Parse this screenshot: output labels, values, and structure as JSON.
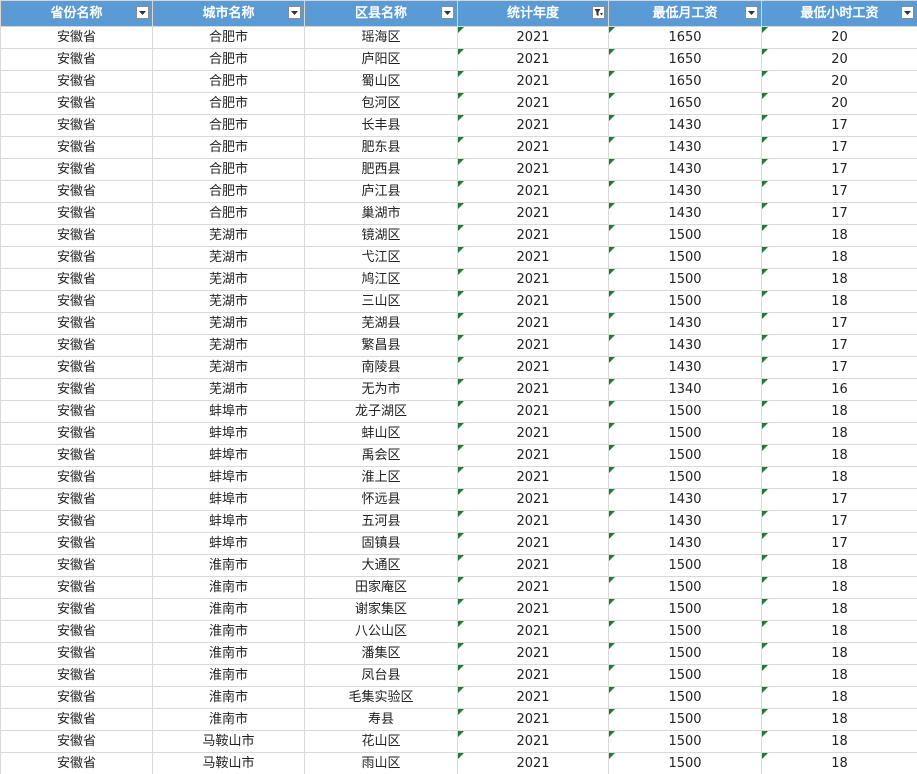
{
  "headers": [
    "省份名称",
    "城市名称",
    "区县名称",
    "统计年度",
    "最低月工资",
    "最低小时工资"
  ],
  "filter_icons": [
    "dropdown-arrow-icon",
    "dropdown-arrow-icon",
    "dropdown-arrow-icon",
    "filter-active-icon",
    "dropdown-arrow-icon",
    "dropdown-arrow-icon"
  ],
  "colors": {
    "header_bg": "#5b9bd5",
    "header_text": "#ffffff",
    "grid": "#d9d9d9",
    "error_marker": "#1e7d32"
  },
  "rows": [
    [
      "安徽省",
      "合肥市",
      "瑶海区",
      "2021",
      "1650",
      "20"
    ],
    [
      "安徽省",
      "合肥市",
      "庐阳区",
      "2021",
      "1650",
      "20"
    ],
    [
      "安徽省",
      "合肥市",
      "蜀山区",
      "2021",
      "1650",
      "20"
    ],
    [
      "安徽省",
      "合肥市",
      "包河区",
      "2021",
      "1650",
      "20"
    ],
    [
      "安徽省",
      "合肥市",
      "长丰县",
      "2021",
      "1430",
      "17"
    ],
    [
      "安徽省",
      "合肥市",
      "肥东县",
      "2021",
      "1430",
      "17"
    ],
    [
      "安徽省",
      "合肥市",
      "肥西县",
      "2021",
      "1430",
      "17"
    ],
    [
      "安徽省",
      "合肥市",
      "庐江县",
      "2021",
      "1430",
      "17"
    ],
    [
      "安徽省",
      "合肥市",
      "巢湖市",
      "2021",
      "1430",
      "17"
    ],
    [
      "安徽省",
      "芜湖市",
      "镜湖区",
      "2021",
      "1500",
      "18"
    ],
    [
      "安徽省",
      "芜湖市",
      "弋江区",
      "2021",
      "1500",
      "18"
    ],
    [
      "安徽省",
      "芜湖市",
      "鸠江区",
      "2021",
      "1500",
      "18"
    ],
    [
      "安徽省",
      "芜湖市",
      "三山区",
      "2021",
      "1500",
      "18"
    ],
    [
      "安徽省",
      "芜湖市",
      "芜湖县",
      "2021",
      "1430",
      "17"
    ],
    [
      "安徽省",
      "芜湖市",
      "繁昌县",
      "2021",
      "1430",
      "17"
    ],
    [
      "安徽省",
      "芜湖市",
      "南陵县",
      "2021",
      "1430",
      "17"
    ],
    [
      "安徽省",
      "芜湖市",
      "无为市",
      "2021",
      "1340",
      "16"
    ],
    [
      "安徽省",
      "蚌埠市",
      "龙子湖区",
      "2021",
      "1500",
      "18"
    ],
    [
      "安徽省",
      "蚌埠市",
      "蚌山区",
      "2021",
      "1500",
      "18"
    ],
    [
      "安徽省",
      "蚌埠市",
      "禹会区",
      "2021",
      "1500",
      "18"
    ],
    [
      "安徽省",
      "蚌埠市",
      "淮上区",
      "2021",
      "1500",
      "18"
    ],
    [
      "安徽省",
      "蚌埠市",
      "怀远县",
      "2021",
      "1430",
      "17"
    ],
    [
      "安徽省",
      "蚌埠市",
      "五河县",
      "2021",
      "1430",
      "17"
    ],
    [
      "安徽省",
      "蚌埠市",
      "固镇县",
      "2021",
      "1430",
      "17"
    ],
    [
      "安徽省",
      "淮南市",
      "大通区",
      "2021",
      "1500",
      "18"
    ],
    [
      "安徽省",
      "淮南市",
      "田家庵区",
      "2021",
      "1500",
      "18"
    ],
    [
      "安徽省",
      "淮南市",
      "谢家集区",
      "2021",
      "1500",
      "18"
    ],
    [
      "安徽省",
      "淮南市",
      "八公山区",
      "2021",
      "1500",
      "18"
    ],
    [
      "安徽省",
      "淮南市",
      "潘集区",
      "2021",
      "1500",
      "18"
    ],
    [
      "安徽省",
      "淮南市",
      "凤台县",
      "2021",
      "1500",
      "18"
    ],
    [
      "安徽省",
      "淮南市",
      "毛集实验区",
      "2021",
      "1500",
      "18"
    ],
    [
      "安徽省",
      "淮南市",
      "寿县",
      "2021",
      "1500",
      "18"
    ],
    [
      "安徽省",
      "马鞍山市",
      "花山区",
      "2021",
      "1500",
      "18"
    ],
    [
      "安徽省",
      "马鞍山市",
      "雨山区",
      "2021",
      "1500",
      "18"
    ]
  ]
}
